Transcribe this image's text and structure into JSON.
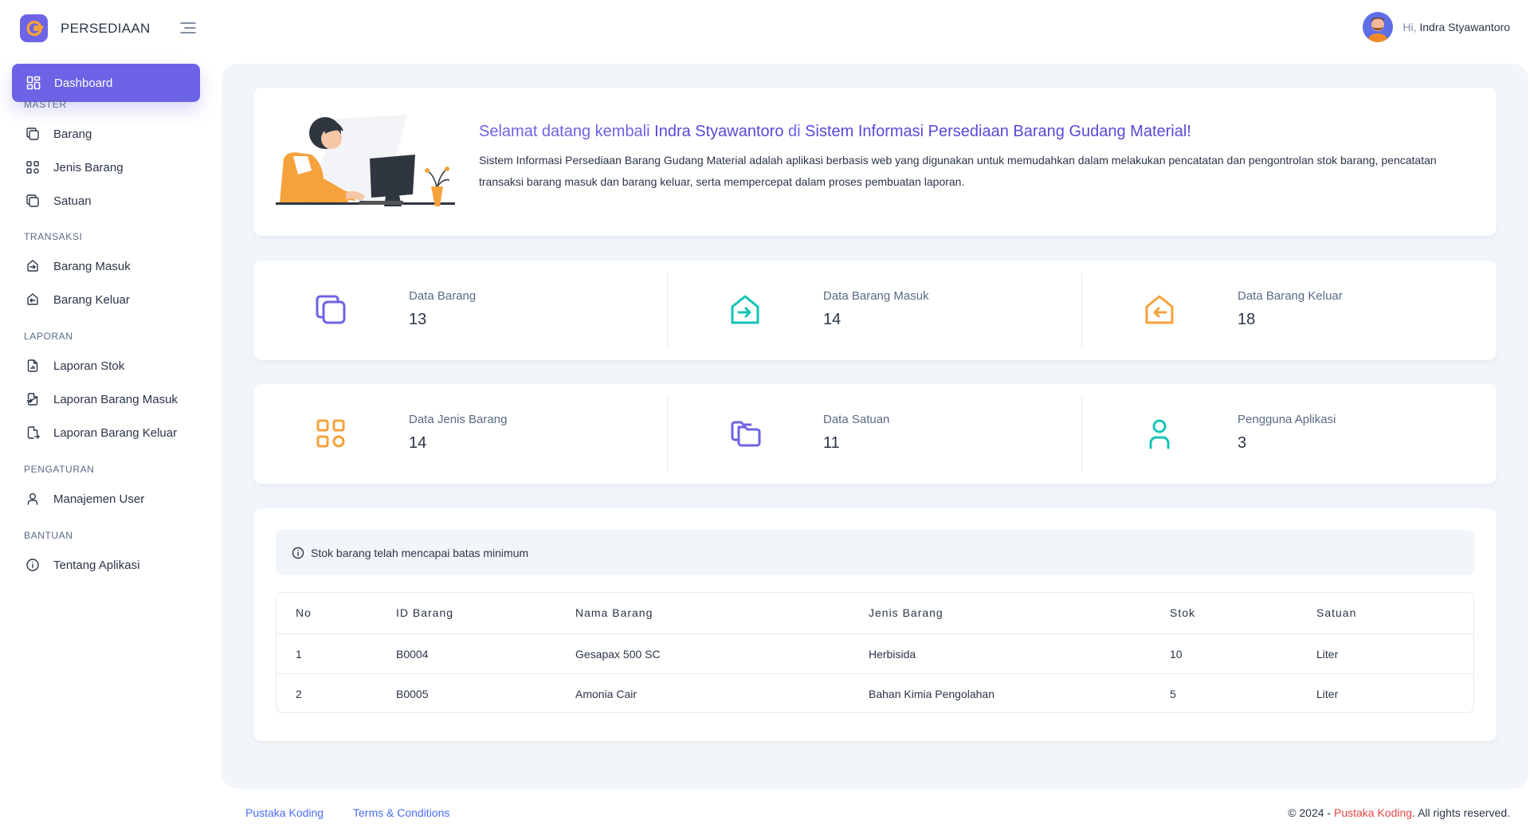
{
  "header": {
    "brand_name": "PERSEDIAAN",
    "greeting_prefix": "Hi,",
    "user_name": "Indra Styawantoro"
  },
  "sidebar": {
    "active": {
      "label": "Dashboard",
      "icon": "dashboard-icon"
    },
    "sections": [
      {
        "title": "MASTER",
        "items": [
          {
            "label": "Barang",
            "icon": "copy-icon"
          },
          {
            "label": "Jenis Barang",
            "icon": "category-icon"
          },
          {
            "label": "Satuan",
            "icon": "copy-icon"
          }
        ]
      },
      {
        "title": "TRANSAKSI",
        "items": [
          {
            "label": "Barang Masuk",
            "icon": "home-in-icon"
          },
          {
            "label": "Barang Keluar",
            "icon": "home-out-icon"
          }
        ]
      },
      {
        "title": "LAPORAN",
        "items": [
          {
            "label": "Laporan Stok",
            "icon": "file-chart-icon"
          },
          {
            "label": "Laporan Barang Masuk",
            "icon": "file-import-icon"
          },
          {
            "label": "Laporan Barang Keluar",
            "icon": "file-export-icon"
          }
        ]
      },
      {
        "title": "PENGATURAN",
        "items": [
          {
            "label": "Manajemen User",
            "icon": "user-icon"
          }
        ]
      },
      {
        "title": "BANTUAN",
        "items": [
          {
            "label": "Tentang Aplikasi",
            "icon": "info-icon"
          }
        ]
      }
    ]
  },
  "welcome": {
    "title_prefix": "Selamat datang kembali",
    "title_name": "Indra Styawantoro",
    "title_middle": "di",
    "title_app": "Sistem Informasi Persediaan Barang Gudang Material!",
    "description": "Sistem Informasi Persediaan Barang Gudang Material adalah aplikasi berbasis web yang digunakan untuk memudahkan dalam melakukan pencatatan dan pengontrolan stok barang, pencatatan transaksi barang masuk dan barang keluar, serta mempercepat dalam proses pembuatan laporan."
  },
  "stats_row1": [
    {
      "label": "Data Barang",
      "value": "13",
      "icon": "copy-icon",
      "color": "#6c63e6"
    },
    {
      "label": "Data Barang Masuk",
      "value": "14",
      "icon": "home-in-icon",
      "color": "#13c4b5"
    },
    {
      "label": "Data Barang Keluar",
      "value": "18",
      "icon": "home-out-icon",
      "color": "#f5a13c"
    }
  ],
  "stats_row2": [
    {
      "label": "Data Jenis Barang",
      "value": "14",
      "icon": "category-icon",
      "color": "#f5a13c"
    },
    {
      "label": "Data Satuan",
      "value": "11",
      "icon": "copy-icon",
      "color": "#6c63e6"
    },
    {
      "label": "Pengguna Aplikasi",
      "value": "3",
      "icon": "user-icon",
      "color": "#13c4b5"
    }
  ],
  "alert": {
    "text": "Stok barang telah mencapai batas minimum"
  },
  "table": {
    "columns": [
      "No",
      "ID Barang",
      "Nama Barang",
      "Jenis Barang",
      "Stok",
      "Satuan"
    ],
    "rows": [
      [
        "1",
        "B0004",
        "Gesapax 500 SC",
        "Herbisida",
        "10",
        "Liter"
      ],
      [
        "2",
        "B0005",
        "Amonia Cair",
        "Bahan Kimia Pengolahan",
        "5",
        "Liter"
      ]
    ]
  },
  "footer": {
    "link1": "Pustaka Koding",
    "link2": "Terms & Conditions",
    "copyright_prefix": "© 2024 -",
    "copyright_brand": "Pustaka Koding",
    "copyright_suffix": ". All rights reserved."
  },
  "colors": {
    "primary": "#6c63e6",
    "teal": "#13c4b5",
    "orange": "#f5a13c",
    "background": "#f2f6fa"
  }
}
